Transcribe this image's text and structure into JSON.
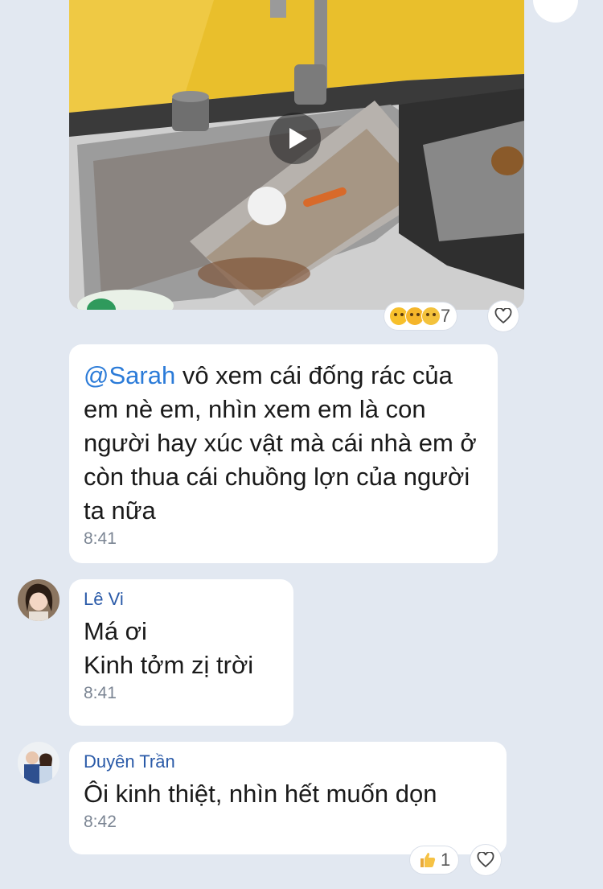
{
  "colors": {
    "background": "#e2e8f1",
    "bubble": "#ffffff",
    "mention": "#2b7bd8",
    "sender": "#2a5aa8",
    "time": "#7b8593"
  },
  "video_message": {
    "reactions": {
      "emojis": [
        "laughing-face-icon",
        "crying-face-icon",
        "scared-face-icon"
      ],
      "count": "7"
    }
  },
  "messages": [
    {
      "mention": "@Sarah",
      "text": " vô xem cái đống rác của em nè em, nhìn xem em là con người hay xúc vật mà cái nhà em ở còn thua cái chuồng lợn của người ta nữa",
      "time": "8:41"
    },
    {
      "sender": "Lê Vi",
      "lines": [
        "Má ơi",
        "Kinh tởm zị trời"
      ],
      "time": "8:41"
    },
    {
      "sender": "Duyên Trần",
      "text": "Ôi kinh thiệt, nhìn hết muốn dọn",
      "time": "8:42",
      "reactions": {
        "emoji": "thumbs-up-icon",
        "count": "1"
      }
    }
  ]
}
